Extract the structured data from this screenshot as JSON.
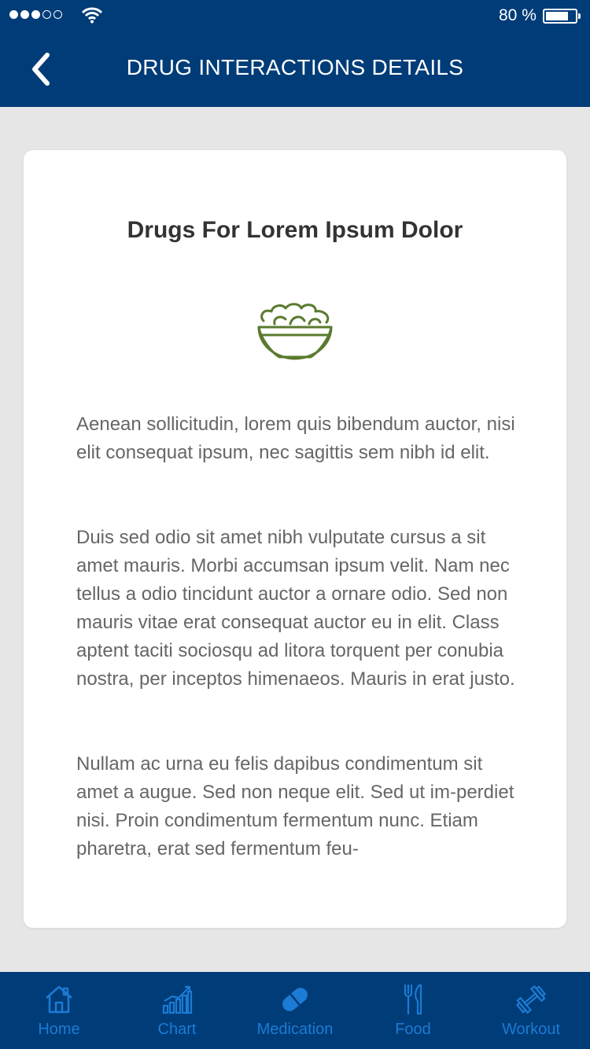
{
  "status": {
    "battery_percent": "80 %",
    "battery_level": 0.8
  },
  "header": {
    "title": "DRUG INTERACTIONS DETAILS"
  },
  "card": {
    "title": "Drugs For Lorem Ipsum Dolor",
    "icon": "salad-bowl-icon",
    "paragraphs": [
      "Aenean sollicitudin, lorem quis bibendum auctor, nisi elit consequat ipsum, nec sagittis sem nibh id elit.",
      "Duis sed odio sit amet nibh vulputate cursus a sit amet mauris. Morbi accumsan ipsum velit. Nam nec tellus a odio tincidunt auctor a ornare odio. Sed non  mauris vitae erat consequat auctor eu in elit. Class aptent taciti sociosqu ad litora torquent per conubia nostra, per inceptos himenaeos. Mauris in erat justo.",
      "Nullam ac urna eu felis dapibus condimentum sit amet a augue. Sed non neque elit. Sed ut im-perdiet nisi. Proin condimentum fermentum nunc. Etiam pharetra, erat sed fermentum feu-"
    ]
  },
  "tabs": [
    {
      "label": "Home",
      "icon": "home-icon"
    },
    {
      "label": "Chart",
      "icon": "chart-icon"
    },
    {
      "label": "Medication",
      "icon": "pill-icon"
    },
    {
      "label": "Food",
      "icon": "fork-knife-icon"
    },
    {
      "label": "Workout",
      "icon": "dumbbell-icon"
    }
  ],
  "colors": {
    "header_bg": "#003c78",
    "tab_label": "#1c7bd4",
    "icon_green": "#5a7a2e"
  }
}
